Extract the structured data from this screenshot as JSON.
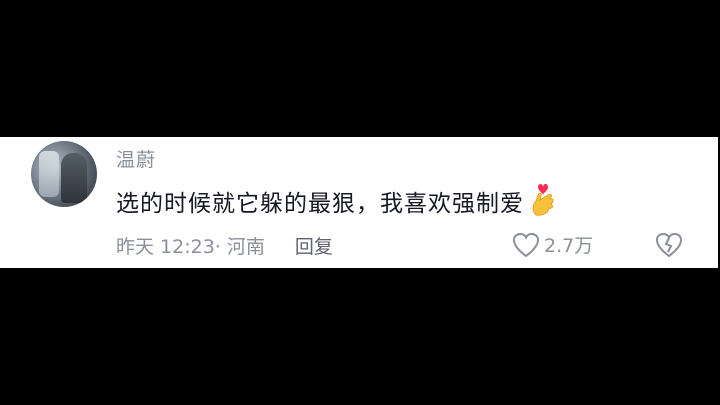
{
  "comment": {
    "username": "温蔚",
    "text": "选的时候就它躲的最狠，我喜欢强制爱",
    "emoji": "finger-heart-emoji",
    "time": "昨天 12:23",
    "location": "· 河南",
    "reply_label": "回复",
    "like_count": "2.7万"
  },
  "colors": {
    "card_bg": "#ffffff",
    "background": "#000000",
    "meta_text": "#8a8f99",
    "body_text": "#161823",
    "emoji_heart": "#fe2c55"
  }
}
